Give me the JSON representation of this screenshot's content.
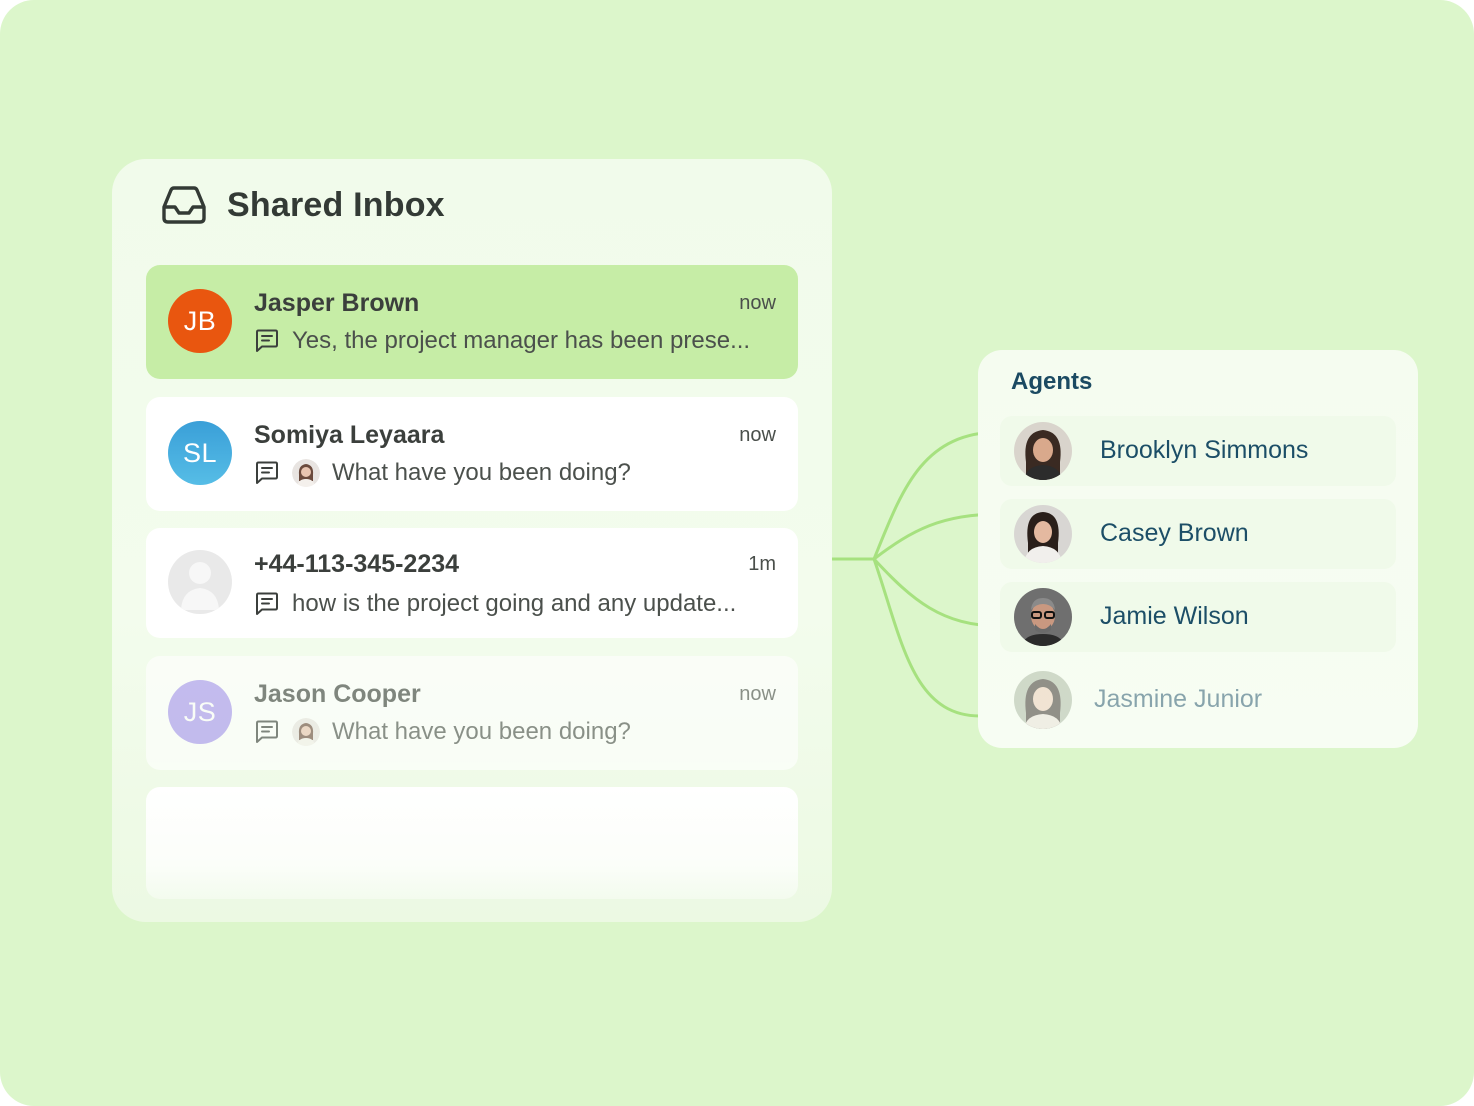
{
  "inbox": {
    "title": "Shared Inbox",
    "icon": "inbox-tray-icon",
    "conversations": [
      {
        "initials": "JB",
        "name": "Jasper Brown",
        "time": "now",
        "preview": "Yes, the project manager has been prese...",
        "avatar_color": "#e9560f",
        "state": "selected"
      },
      {
        "initials": "SL",
        "name": "Somiya Leyaara",
        "time": "now",
        "preview": "What have you been doing?",
        "avatar_color": "#3aa6da"
      },
      {
        "initials": "",
        "name": "+44-113-345-2234",
        "time": "1m",
        "preview": "how is the project going and any update...",
        "avatar_color": "#e6e6e6"
      },
      {
        "initials": "JS",
        "name": "Jason Cooper",
        "time": "now",
        "preview": "What have you been doing?",
        "avatar_color": "#b3a6f3",
        "state": "faded"
      }
    ]
  },
  "agents": {
    "title": "Agents",
    "list": [
      {
        "name": "Brooklyn Simmons"
      },
      {
        "name": "Casey Brown"
      },
      {
        "name": "Jamie Wilson"
      },
      {
        "name": "Jasmine Junior",
        "state": "faded"
      }
    ]
  },
  "colors": {
    "background": "#dcf6cb",
    "selected": "#c6eda6",
    "connector": "#9fdf78",
    "agent_text": "#1c4e67"
  }
}
